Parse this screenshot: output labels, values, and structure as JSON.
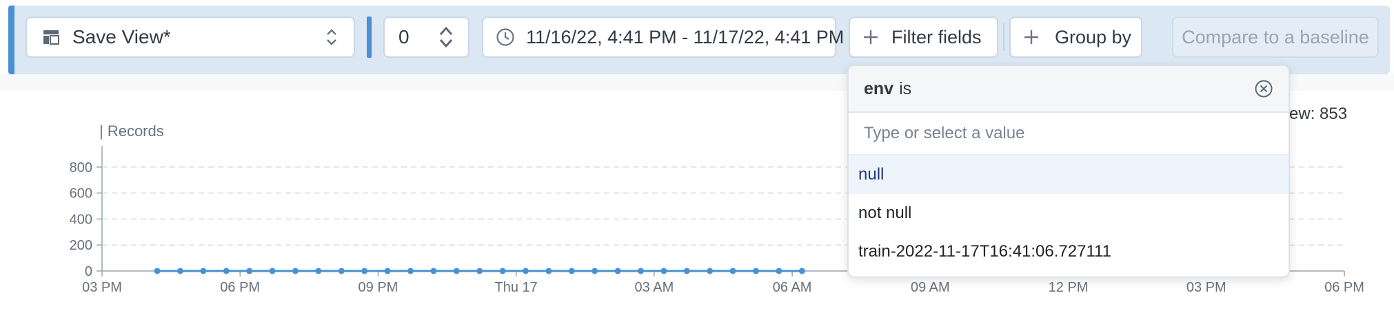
{
  "toolbar": {
    "save_view_label": "Save View*",
    "refresh_value": "0",
    "time_range_label": "11/16/22, 4:41 PM - 11/17/22, 4:41 PM",
    "filter_fields_label": "Filter fields",
    "group_by_label": "Group by",
    "compare_label": "Compare to a baseline"
  },
  "summary": {
    "count_text": "ew: 853"
  },
  "dropdown": {
    "field_key": "env",
    "operator": "is",
    "placeholder": "Type or select a value",
    "options": [
      "null",
      "not null",
      "train-2022-11-17T16:41:06.727111"
    ],
    "active_index": 0
  },
  "colors": {
    "accent": "#4a90d2",
    "toolbar_bg": "#dbe7f3",
    "series": "#4a90d2"
  },
  "icons": {
    "save_view": "layout-icon",
    "save_view_chevron": "up-down-chevron-icon",
    "refresh_chevron": "up-down-chevron-icon",
    "time_range": "clock-icon",
    "filter_fields": "plus-icon",
    "group_by": "plus-icon",
    "dropdown_close": "close-circle-icon"
  },
  "chart_data": {
    "type": "line",
    "ylabel": "| Records",
    "ylim": [
      0,
      900
    ],
    "y_ticks": [
      0,
      200,
      400,
      600,
      800
    ],
    "x_tick_labels": [
      "03 PM",
      "06 PM",
      "09 PM",
      "Thu 17",
      "03 AM",
      "06 AM",
      "09 AM",
      "12 PM",
      "03 PM",
      "06 PM"
    ],
    "grid": true,
    "series": [
      {
        "values": [
          0,
          0,
          0,
          0,
          0,
          0,
          0,
          0,
          0,
          0,
          0,
          0,
          0,
          0,
          0,
          0,
          0,
          0,
          0,
          0,
          0,
          0,
          0,
          0,
          0,
          0,
          0,
          0,
          0
        ]
      }
    ]
  }
}
